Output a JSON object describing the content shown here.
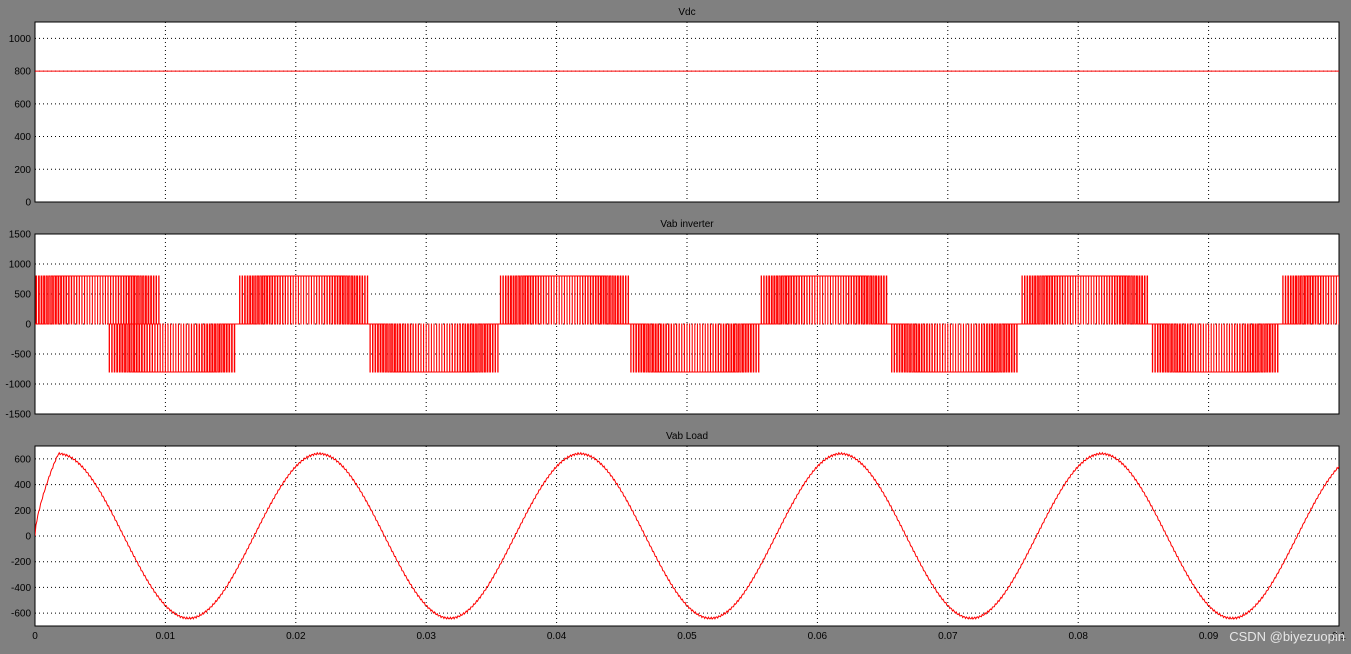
{
  "chart_data": [
    {
      "type": "line",
      "title": "Vdc",
      "ylim": [
        0,
        1100
      ],
      "yticks": [
        0,
        200,
        400,
        600,
        800,
        1000
      ],
      "xlim": [
        0,
        0.1
      ],
      "grid": true,
      "series": [
        {
          "x": [
            0,
            0.1
          ],
          "values": [
            800,
            800
          ]
        }
      ]
    },
    {
      "type": "line",
      "title": "Vab inverter",
      "ylim": [
        -1500,
        1500
      ],
      "yticks": [
        -1500,
        -1000,
        -500,
        0,
        500,
        1000,
        1500
      ],
      "xlim": [
        0,
        0.1
      ],
      "grid": true,
      "pwm": {
        "amplitude": 800,
        "fundamental_hz": 50,
        "switching_period": 0.0002,
        "positive_block_starts": [
          -0.0004,
          0.0156,
          0.0356,
          0.0556,
          0.0756,
          0.0956
        ],
        "negative_block_starts": [
          0.0056,
          0.0256,
          0.0456,
          0.0656,
          0.0856
        ],
        "block_width": 0.0098
      }
    },
    {
      "type": "line",
      "title": "Vab Load",
      "ylim": [
        -700,
        700
      ],
      "yticks": [
        -600,
        -400,
        -200,
        0,
        200,
        400,
        600
      ],
      "xlim": [
        0,
        0.1
      ],
      "xticks": [
        0,
        0.01,
        0.02,
        0.03,
        0.04,
        0.05,
        0.06,
        0.07,
        0.08,
        0.09,
        0.1
      ],
      "xticklabels": [
        "0",
        "0.01",
        "0.02",
        "0.03",
        "0.04",
        "0.05",
        "0.06",
        "0.07",
        "0.08",
        "0.09",
        "0.1"
      ],
      "grid": true,
      "sine": {
        "amplitude": 640,
        "frequency_hz": 50,
        "peak_at": 0.0018,
        "ripple": 8
      }
    }
  ],
  "colors": {
    "trace": "#ff0000",
    "background": "#808080",
    "axes": "#ffffff",
    "grid": "#000000"
  },
  "watermark": "CSDN @biyezuopin"
}
